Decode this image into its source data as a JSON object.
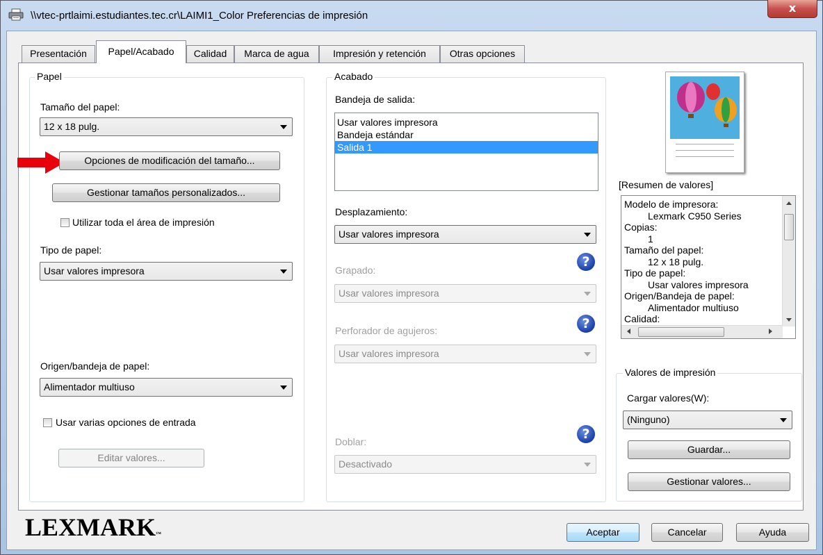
{
  "window": {
    "title": "\\\\vtec-prtlaimi.estudiantes.tec.cr\\LAIMI1_Color Preferencias de impresión",
    "close_label": "x"
  },
  "tabs": [
    {
      "label": "Presentación",
      "active": false
    },
    {
      "label": "Papel/Acabado",
      "active": true
    },
    {
      "label": "Calidad",
      "active": false
    },
    {
      "label": "Marca de agua",
      "active": false
    },
    {
      "label": "Impresión y retención",
      "active": false
    },
    {
      "label": "Otras opciones",
      "active": false
    }
  ],
  "papel": {
    "group_label": "Papel",
    "size_label": "Tamaño del papel:",
    "size_value": "12 x 18 pulg.",
    "resize_options_button": "Opciones de modificación del tamaño...",
    "custom_sizes_button": "Gestionar tamaños personalizados...",
    "use_full_area_label": "Utilizar toda el área de impresión",
    "type_label": "Tipo de papel:",
    "type_value": "Usar valores impresora",
    "source_label": "Origen/bandeja de papel:",
    "source_value": "Alimentador multiuso",
    "multi_input_label": "Usar varias opciones de entrada",
    "edit_values_button": "Editar valores..."
  },
  "acabado": {
    "group_label": "Acabado",
    "output_tray_label": "Bandeja de salida:",
    "output_tray_items": [
      "Usar valores impresora",
      "Bandeja estándar",
      "Salida 1"
    ],
    "output_tray_selected": 2,
    "offset_label": "Desplazamiento:",
    "offset_value": "Usar valores impresora",
    "staple_label": "Grapado:",
    "staple_value": "Usar valores impresora",
    "hole_punch_label": "Perforador de agujeros:",
    "hole_punch_value": "Usar valores impresora",
    "fold_label": "Doblar:",
    "fold_value": "Desactivado",
    "help_symbol": "?"
  },
  "summary": {
    "label": "[Resumen de valores]",
    "lines": [
      {
        "text": "Modelo de impresora:",
        "indent": false
      },
      {
        "text": "Lexmark C950 Series",
        "indent": true
      },
      {
        "text": "Copias:",
        "indent": false
      },
      {
        "text": "1",
        "indent": true
      },
      {
        "text": "Tamaño del papel:",
        "indent": false
      },
      {
        "text": "12 x 18 pulg.",
        "indent": true
      },
      {
        "text": "Tipo de papel:",
        "indent": false
      },
      {
        "text": "Usar valores impresora",
        "indent": true
      },
      {
        "text": "Origen/Bandeja de papel:",
        "indent": false
      },
      {
        "text": "Alimentador multiuso",
        "indent": true
      },
      {
        "text": "Calidad:",
        "indent": false
      }
    ]
  },
  "print_values": {
    "group_label": "Valores de impresión",
    "load_label": "Cargar valores(W):",
    "load_value": "(Ninguno)",
    "save_button": "Guardar...",
    "manage_button": "Gestionar valores..."
  },
  "footer": {
    "logo": "LEXMARK",
    "ok_button": "Aceptar",
    "cancel_button": "Cancelar",
    "help_button": "Ayuda"
  },
  "colors": {
    "arrow_annotation": "#e8000b",
    "selection": "#3399ff",
    "help_icon": "#1a3fa8"
  },
  "icons": [
    "printer-icon",
    "close-icon",
    "help-icon",
    "dropdown-arrow-icon",
    "red-arrow-annotation-icon",
    "balloons-preview-icon"
  ]
}
